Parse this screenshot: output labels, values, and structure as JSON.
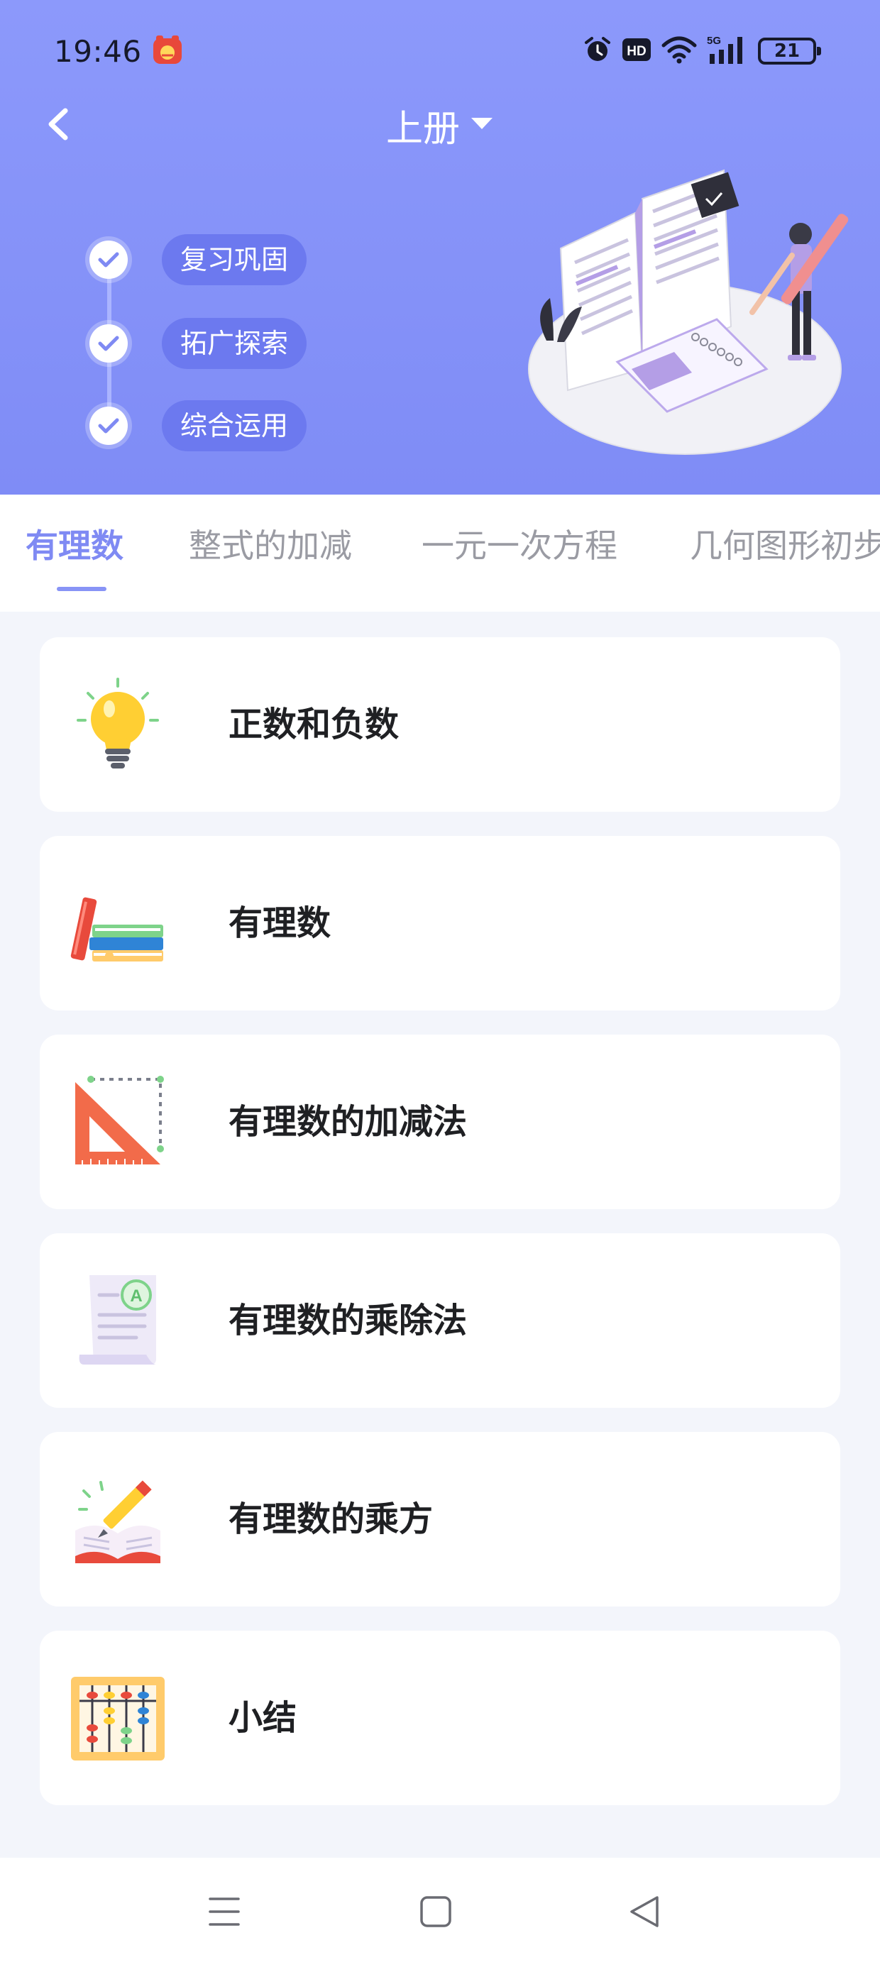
{
  "status_bar": {
    "time": "19:46",
    "network": "5G",
    "hd": "HD",
    "battery": "21"
  },
  "header": {
    "volume": "上册",
    "steps": [
      {
        "label": "复习巩固"
      },
      {
        "label": "拓广探索"
      },
      {
        "label": "综合运用"
      }
    ]
  },
  "tabs": [
    {
      "label": "有理数",
      "active": true
    },
    {
      "label": "整式的加减",
      "active": false
    },
    {
      "label": "一元一次方程",
      "active": false
    },
    {
      "label": "几何图形初步",
      "active": false
    }
  ],
  "lessons": [
    {
      "title": "正数和负数",
      "icon": "lightbulb-icon"
    },
    {
      "title": "有理数",
      "icon": "books-icon"
    },
    {
      "title": "有理数的加减法",
      "icon": "set-square-icon"
    },
    {
      "title": "有理数的乘除法",
      "icon": "graded-paper-icon"
    },
    {
      "title": "有理数的乘方",
      "icon": "pencil-book-icon"
    },
    {
      "title": "小结",
      "icon": "abacus-icon"
    }
  ],
  "colors": {
    "header": "#8593f8",
    "accent": "#7f8af3",
    "background": "#f3f5fb",
    "pill": "#6c79ef"
  }
}
